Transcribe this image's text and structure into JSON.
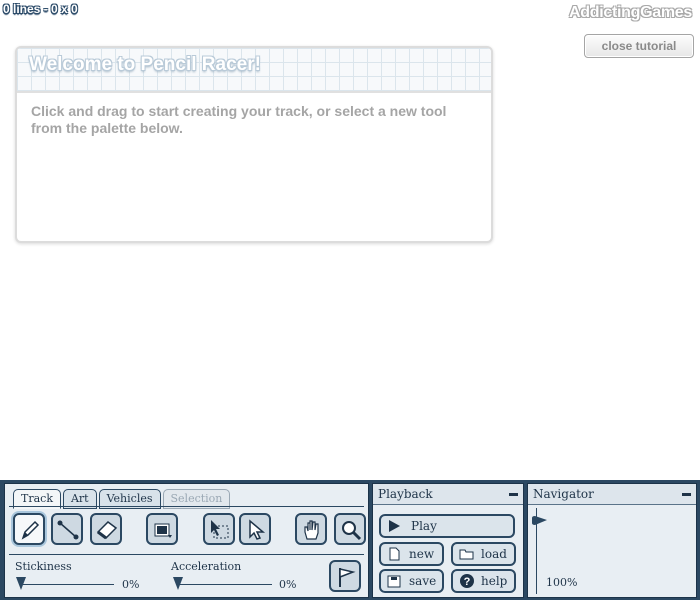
{
  "status": {
    "text": "0 lines - 0 x 0"
  },
  "brand": {
    "prefix": "Addicting",
    "suffix": "Games"
  },
  "close_tutorial": {
    "label": "close tutorial"
  },
  "tutorial": {
    "title": "Welcome to Pencil Racer!",
    "body": "Click and drag to start creating your track, or select a new tool from the palette below."
  },
  "toolbar": {
    "tabs": [
      "Track",
      "Art",
      "Vehicles",
      "Selection"
    ],
    "active_tab": "Track",
    "disabled_tabs": [
      "Selection"
    ],
    "tools": [
      "pencil",
      "line",
      "eraser",
      "color",
      "select-area",
      "select",
      "pan",
      "zoom"
    ],
    "sliders": [
      {
        "label": "Stickiness",
        "value": "0%"
      },
      {
        "label": "Acceleration",
        "value": "0%"
      }
    ]
  },
  "playback": {
    "title": "Playback",
    "buttons": {
      "play": "Play",
      "new": "new",
      "load": "load",
      "save": "save",
      "help": "help"
    }
  },
  "navigator": {
    "title": "Navigator",
    "zoom": "100%"
  },
  "colors": {
    "toolbar_bg": "#2b4862",
    "panel_bg": "#e8eef3",
    "accent": "#2b4862"
  }
}
